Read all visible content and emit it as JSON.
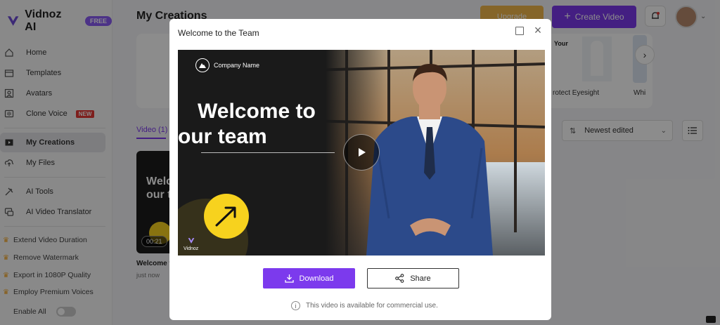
{
  "app": {
    "logo_text": "Vidnoz AI",
    "free_badge": "FREE"
  },
  "sidebar": {
    "items": [
      {
        "label": "Home",
        "icon": "home-icon"
      },
      {
        "label": "Templates",
        "icon": "templates-icon"
      },
      {
        "label": "Avatars",
        "icon": "avatar-icon"
      },
      {
        "label": "Clone Voice",
        "icon": "voice-icon",
        "badge": "NEW"
      },
      {
        "label": "My Creations",
        "icon": "creations-icon",
        "active": true
      },
      {
        "label": "My Files",
        "icon": "files-icon"
      },
      {
        "label": "AI Tools",
        "icon": "tools-icon"
      },
      {
        "label": "AI Video Translator",
        "icon": "translator-icon"
      }
    ],
    "premium": [
      "Extend Video Duration",
      "Remove Watermark",
      "Export in 1080P Quality",
      "Employ Premium Voices"
    ],
    "enable_all": "Enable All"
  },
  "header": {
    "title": "My Creations",
    "upgrade": "Upgrade",
    "create_video": "Create Video"
  },
  "templates": {
    "card1_heading": "Your",
    "card1_caption": "rotect Eyesight",
    "card2_caption": "Whi"
  },
  "tabs": {
    "video": "Video (1)"
  },
  "sort": {
    "selected": "Newest edited"
  },
  "video_card": {
    "thumb_text_1": "Welc",
    "thumb_text_2": "our t",
    "duration": "00:21",
    "title": "Welcome t",
    "time": "just now"
  },
  "modal": {
    "title": "Welcome to the Team",
    "player": {
      "company": "Company Name",
      "headline_1": "Welcome to",
      "headline_2": "our team",
      "watermark": "Vidnoz"
    },
    "download": "Download",
    "share": "Share",
    "notice": "This video is available for commercial use."
  },
  "colors": {
    "accent": "#7c3aed",
    "upgrade": "#f2b84b",
    "highlight_yellow": "#f7d21e"
  }
}
